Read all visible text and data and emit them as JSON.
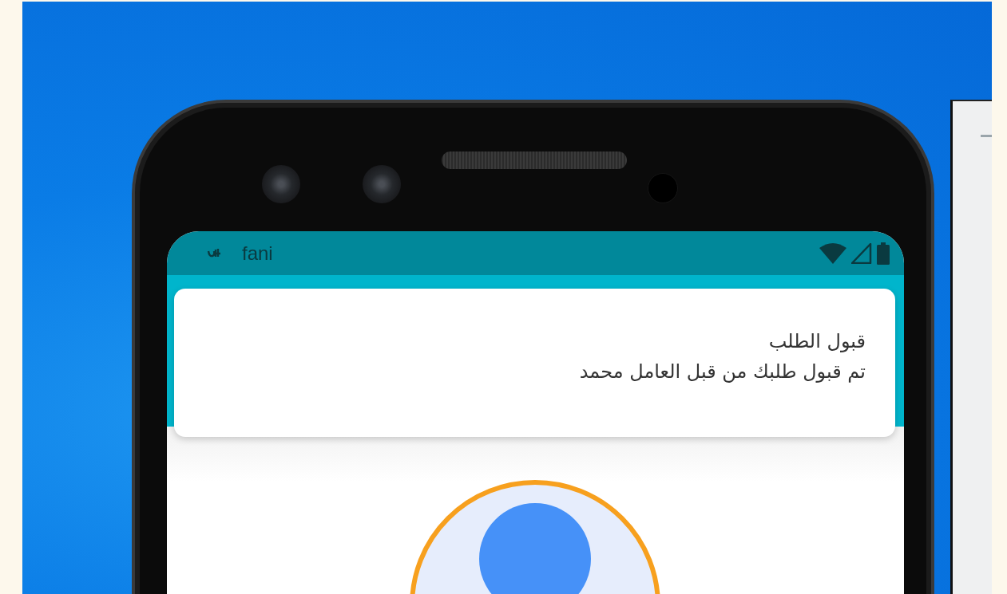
{
  "status_bar": {
    "app_name": "fani"
  },
  "notification": {
    "title": "قبول الطلب",
    "message": "تم قبول طلبك من قبل العامل محمد"
  }
}
